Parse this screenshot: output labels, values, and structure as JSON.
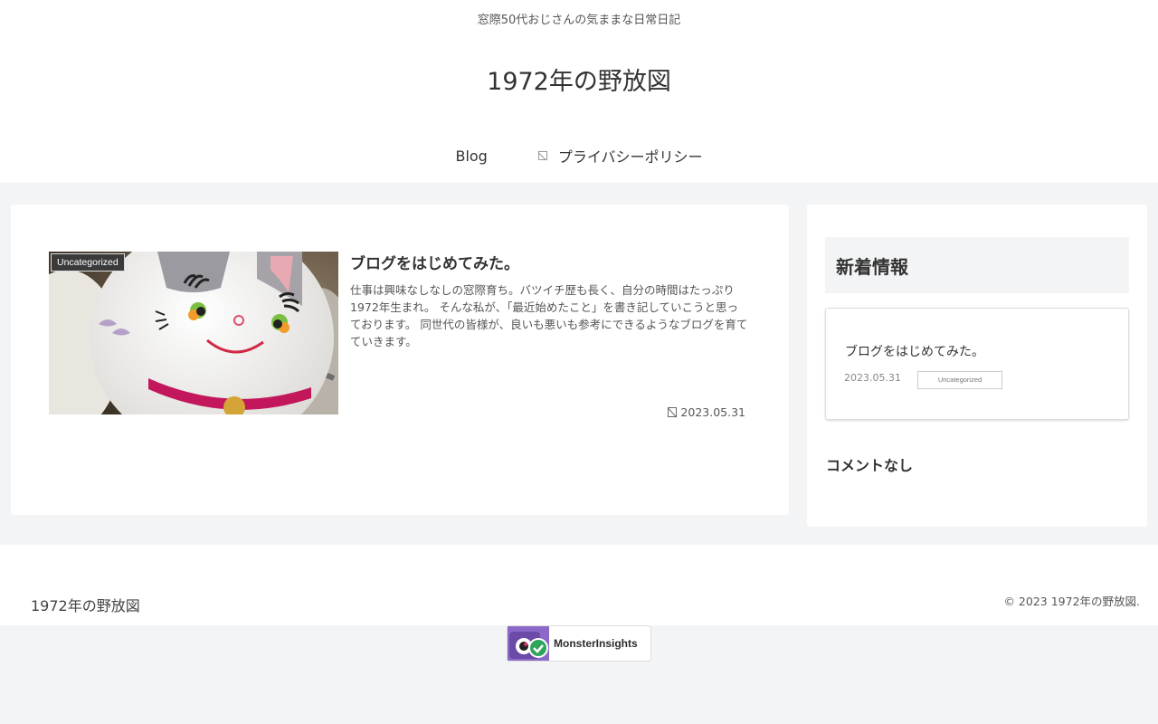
{
  "header": {
    "tagline": "窓際50代おじさんの気ままな日常日記",
    "site_title": "1972年の野放図",
    "nav": [
      {
        "label": "Blog"
      },
      {
        "label": "プライバシーポリシー",
        "icon": "broken-image-icon"
      }
    ]
  },
  "main": {
    "entry": {
      "category": "Uncategorized",
      "title": "ブログをはじめてみた。",
      "excerpt": "仕事は興味なしなしの窓際育ち。バツイチ歴も長く、自分の時間はたっぷり1972年生まれ。 そんな私が、「最近始めたこと」を書き記していこうと思っております。 同世代の皆様が、良いも悪いも参考にできるようなブログを育てていきます。",
      "date": "2023.05.31",
      "thumbnail": "maneki-neko-photo"
    }
  },
  "sidebar": {
    "widget_title": "新着情報",
    "new_entry": {
      "title": "ブログをはじめてみた。",
      "date": "2023.05.31",
      "category": "Uncategorized"
    },
    "comments_heading": "コメントなし"
  },
  "footer": {
    "site_title": "1972年の野放図",
    "copyright": "© 2023 1972年の野放図."
  },
  "badge": {
    "label": "MonsterInsights"
  },
  "colors": {
    "background": "#f3f4f5",
    "card": "#ffffff",
    "text": "#333333",
    "category_label_bg": "#3a3a3a"
  }
}
